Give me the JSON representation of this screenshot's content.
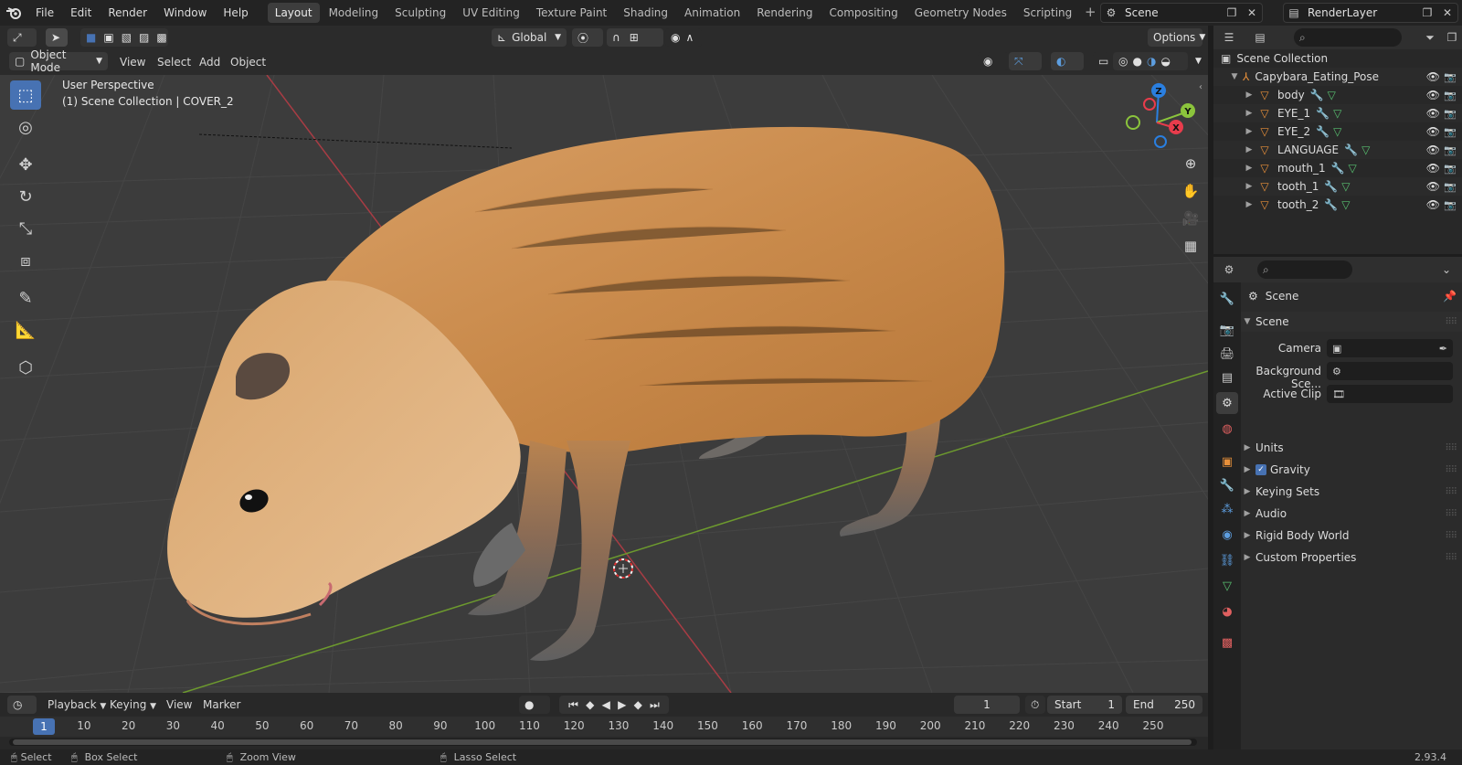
{
  "menus": [
    "File",
    "Edit",
    "Render",
    "Window",
    "Help"
  ],
  "workspaces": [
    "Layout",
    "Modeling",
    "Sculpting",
    "UV Editing",
    "Texture Paint",
    "Shading",
    "Animation",
    "Rendering",
    "Compositing",
    "Geometry Nodes",
    "Scripting"
  ],
  "active_workspace": "Layout",
  "scene_name": "Scene",
  "view_layer": "RenderLayer",
  "viewport": {
    "mode": "Object Mode",
    "menus": [
      "View",
      "Select",
      "Add",
      "Object"
    ],
    "transform_orientation": "Global",
    "options_label": "Options",
    "perspective_label": "User Perspective",
    "collection_label": "(1) Scene Collection | COVER_2"
  },
  "outliner": {
    "root": "Scene Collection",
    "collection": "Capybara_Eating_Pose",
    "objects": [
      "body",
      "EYE_1",
      "EYE_2",
      "LANGUAGE",
      "mouth_1",
      "tooth_1",
      "tooth_2"
    ]
  },
  "properties": {
    "context": "Scene",
    "panel_title": "Scene",
    "fields": [
      {
        "label": "Camera",
        "value": ""
      },
      {
        "label": "Background Sce...",
        "value": ""
      },
      {
        "label": "Active Clip",
        "value": ""
      }
    ],
    "subpanels": [
      "Units",
      "Gravity",
      "Keying Sets",
      "Audio",
      "Rigid Body World",
      "Custom Properties"
    ],
    "gravity_checked": true
  },
  "timeline": {
    "menus": [
      "Playback",
      "Keying",
      "View",
      "Marker"
    ],
    "current_frame": "1",
    "start_label": "Start",
    "start": "1",
    "end_label": "End",
    "end": "250",
    "ticks": [
      "1",
      "10",
      "20",
      "30",
      "40",
      "50",
      "60",
      "70",
      "80",
      "90",
      "100",
      "110",
      "120",
      "130",
      "140",
      "150",
      "160",
      "170",
      "180",
      "190",
      "200",
      "210",
      "220",
      "230",
      "240",
      "250"
    ]
  },
  "status": {
    "select": "Select",
    "box_select": "Box Select",
    "zoom_view": "Zoom View",
    "lasso_select": "Lasso Select",
    "version": "2.93.4"
  },
  "colors": {
    "accent": "#4772b3",
    "mesh_icon": "#e8903a",
    "axis_x": "#e83c4c",
    "axis_y": "#8bc43c",
    "axis_z": "#2a7fe0"
  }
}
